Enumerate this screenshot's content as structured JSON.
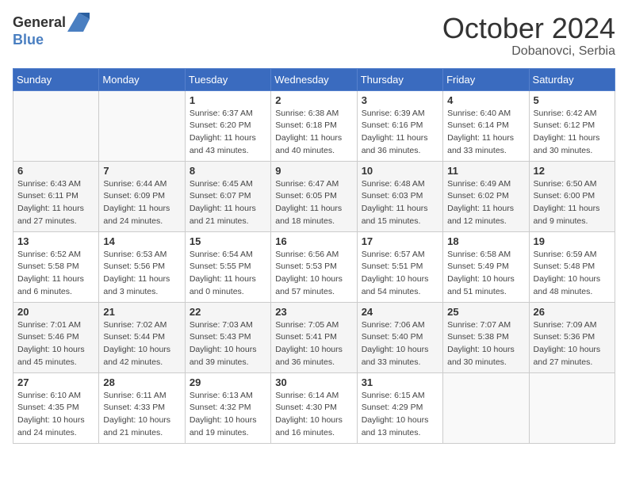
{
  "header": {
    "logo_general": "General",
    "logo_blue": "Blue",
    "month": "October 2024",
    "location": "Dobanovci, Serbia"
  },
  "days_of_week": [
    "Sunday",
    "Monday",
    "Tuesday",
    "Wednesday",
    "Thursday",
    "Friday",
    "Saturday"
  ],
  "weeks": [
    [
      {
        "day": "",
        "sunrise": "",
        "sunset": "",
        "daylight": ""
      },
      {
        "day": "",
        "sunrise": "",
        "sunset": "",
        "daylight": ""
      },
      {
        "day": "1",
        "sunrise": "Sunrise: 6:37 AM",
        "sunset": "Sunset: 6:20 PM",
        "daylight": "Daylight: 11 hours and 43 minutes."
      },
      {
        "day": "2",
        "sunrise": "Sunrise: 6:38 AM",
        "sunset": "Sunset: 6:18 PM",
        "daylight": "Daylight: 11 hours and 40 minutes."
      },
      {
        "day": "3",
        "sunrise": "Sunrise: 6:39 AM",
        "sunset": "Sunset: 6:16 PM",
        "daylight": "Daylight: 11 hours and 36 minutes."
      },
      {
        "day": "4",
        "sunrise": "Sunrise: 6:40 AM",
        "sunset": "Sunset: 6:14 PM",
        "daylight": "Daylight: 11 hours and 33 minutes."
      },
      {
        "day": "5",
        "sunrise": "Sunrise: 6:42 AM",
        "sunset": "Sunset: 6:12 PM",
        "daylight": "Daylight: 11 hours and 30 minutes."
      }
    ],
    [
      {
        "day": "6",
        "sunrise": "Sunrise: 6:43 AM",
        "sunset": "Sunset: 6:11 PM",
        "daylight": "Daylight: 11 hours and 27 minutes."
      },
      {
        "day": "7",
        "sunrise": "Sunrise: 6:44 AM",
        "sunset": "Sunset: 6:09 PM",
        "daylight": "Daylight: 11 hours and 24 minutes."
      },
      {
        "day": "8",
        "sunrise": "Sunrise: 6:45 AM",
        "sunset": "Sunset: 6:07 PM",
        "daylight": "Daylight: 11 hours and 21 minutes."
      },
      {
        "day": "9",
        "sunrise": "Sunrise: 6:47 AM",
        "sunset": "Sunset: 6:05 PM",
        "daylight": "Daylight: 11 hours and 18 minutes."
      },
      {
        "day": "10",
        "sunrise": "Sunrise: 6:48 AM",
        "sunset": "Sunset: 6:03 PM",
        "daylight": "Daylight: 11 hours and 15 minutes."
      },
      {
        "day": "11",
        "sunrise": "Sunrise: 6:49 AM",
        "sunset": "Sunset: 6:02 PM",
        "daylight": "Daylight: 11 hours and 12 minutes."
      },
      {
        "day": "12",
        "sunrise": "Sunrise: 6:50 AM",
        "sunset": "Sunset: 6:00 PM",
        "daylight": "Daylight: 11 hours and 9 minutes."
      }
    ],
    [
      {
        "day": "13",
        "sunrise": "Sunrise: 6:52 AM",
        "sunset": "Sunset: 5:58 PM",
        "daylight": "Daylight: 11 hours and 6 minutes."
      },
      {
        "day": "14",
        "sunrise": "Sunrise: 6:53 AM",
        "sunset": "Sunset: 5:56 PM",
        "daylight": "Daylight: 11 hours and 3 minutes."
      },
      {
        "day": "15",
        "sunrise": "Sunrise: 6:54 AM",
        "sunset": "Sunset: 5:55 PM",
        "daylight": "Daylight: 11 hours and 0 minutes."
      },
      {
        "day": "16",
        "sunrise": "Sunrise: 6:56 AM",
        "sunset": "Sunset: 5:53 PM",
        "daylight": "Daylight: 10 hours and 57 minutes."
      },
      {
        "day": "17",
        "sunrise": "Sunrise: 6:57 AM",
        "sunset": "Sunset: 5:51 PM",
        "daylight": "Daylight: 10 hours and 54 minutes."
      },
      {
        "day": "18",
        "sunrise": "Sunrise: 6:58 AM",
        "sunset": "Sunset: 5:49 PM",
        "daylight": "Daylight: 10 hours and 51 minutes."
      },
      {
        "day": "19",
        "sunrise": "Sunrise: 6:59 AM",
        "sunset": "Sunset: 5:48 PM",
        "daylight": "Daylight: 10 hours and 48 minutes."
      }
    ],
    [
      {
        "day": "20",
        "sunrise": "Sunrise: 7:01 AM",
        "sunset": "Sunset: 5:46 PM",
        "daylight": "Daylight: 10 hours and 45 minutes."
      },
      {
        "day": "21",
        "sunrise": "Sunrise: 7:02 AM",
        "sunset": "Sunset: 5:44 PM",
        "daylight": "Daylight: 10 hours and 42 minutes."
      },
      {
        "day": "22",
        "sunrise": "Sunrise: 7:03 AM",
        "sunset": "Sunset: 5:43 PM",
        "daylight": "Daylight: 10 hours and 39 minutes."
      },
      {
        "day": "23",
        "sunrise": "Sunrise: 7:05 AM",
        "sunset": "Sunset: 5:41 PM",
        "daylight": "Daylight: 10 hours and 36 minutes."
      },
      {
        "day": "24",
        "sunrise": "Sunrise: 7:06 AM",
        "sunset": "Sunset: 5:40 PM",
        "daylight": "Daylight: 10 hours and 33 minutes."
      },
      {
        "day": "25",
        "sunrise": "Sunrise: 7:07 AM",
        "sunset": "Sunset: 5:38 PM",
        "daylight": "Daylight: 10 hours and 30 minutes."
      },
      {
        "day": "26",
        "sunrise": "Sunrise: 7:09 AM",
        "sunset": "Sunset: 5:36 PM",
        "daylight": "Daylight: 10 hours and 27 minutes."
      }
    ],
    [
      {
        "day": "27",
        "sunrise": "Sunrise: 6:10 AM",
        "sunset": "Sunset: 4:35 PM",
        "daylight": "Daylight: 10 hours and 24 minutes."
      },
      {
        "day": "28",
        "sunrise": "Sunrise: 6:11 AM",
        "sunset": "Sunset: 4:33 PM",
        "daylight": "Daylight: 10 hours and 21 minutes."
      },
      {
        "day": "29",
        "sunrise": "Sunrise: 6:13 AM",
        "sunset": "Sunset: 4:32 PM",
        "daylight": "Daylight: 10 hours and 19 minutes."
      },
      {
        "day": "30",
        "sunrise": "Sunrise: 6:14 AM",
        "sunset": "Sunset: 4:30 PM",
        "daylight": "Daylight: 10 hours and 16 minutes."
      },
      {
        "day": "31",
        "sunrise": "Sunrise: 6:15 AM",
        "sunset": "Sunset: 4:29 PM",
        "daylight": "Daylight: 10 hours and 13 minutes."
      },
      {
        "day": "",
        "sunrise": "",
        "sunset": "",
        "daylight": ""
      },
      {
        "day": "",
        "sunrise": "",
        "sunset": "",
        "daylight": ""
      }
    ]
  ]
}
